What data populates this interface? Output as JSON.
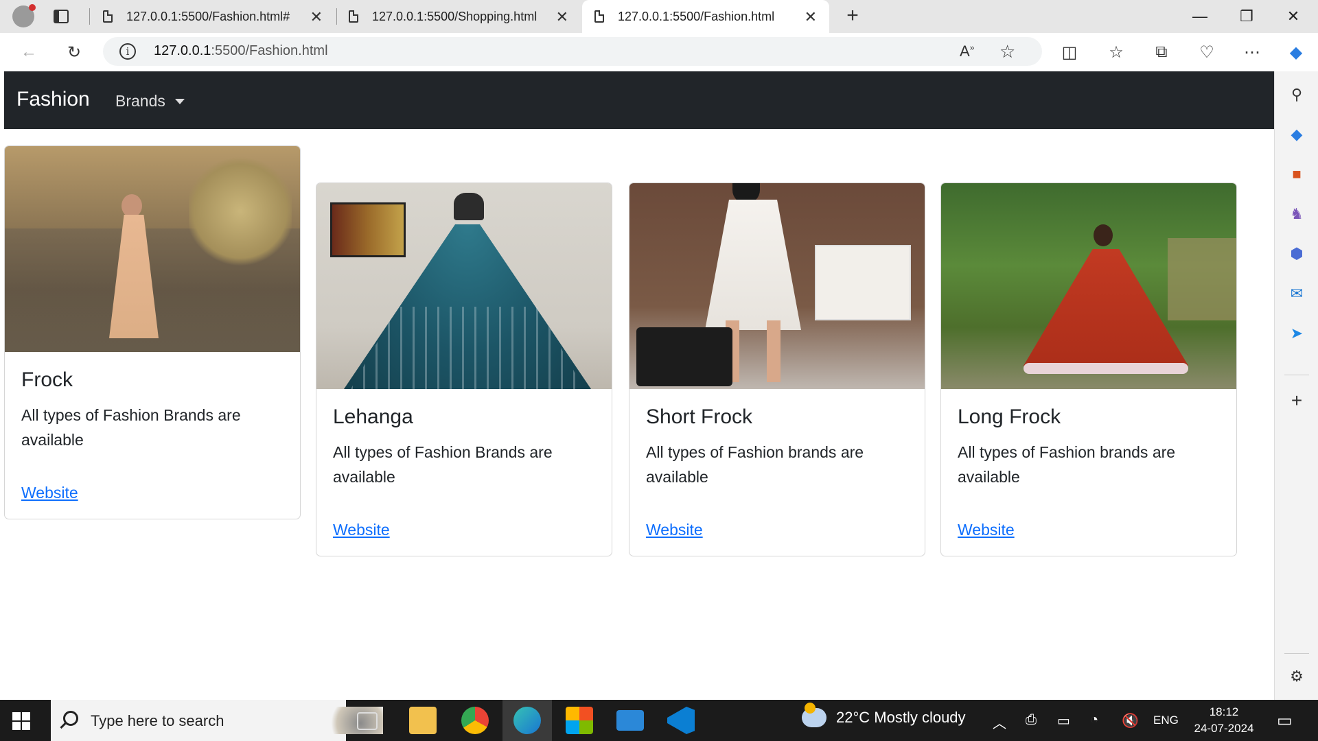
{
  "browser": {
    "tabs": [
      {
        "title": "127.0.0.1:5500/Fashion.html#",
        "active": false
      },
      {
        "title": "127.0.0.1:5500/Shopping.html",
        "active": false
      },
      {
        "title": "127.0.0.1:5500/Fashion.html",
        "active": true
      }
    ],
    "url_host": "127.0.0.1",
    "url_path": ":5500/Fashion.html"
  },
  "page": {
    "navbar": {
      "brand": "Fashion",
      "dropdown_label": "Brands"
    },
    "cards": [
      {
        "title": "Frock",
        "text": "All types of Fashion Brands are available",
        "link": "Website"
      },
      {
        "title": "Lehanga",
        "text": "All types of Fashion Brands are available",
        "link": "Website"
      },
      {
        "title": "Short Frock",
        "text": "All types of Fashion brands are available",
        "link": "Website"
      },
      {
        "title": "Long Frock",
        "text": "All types of Fashion brands are available",
        "link": "Website"
      }
    ]
  },
  "taskbar": {
    "search_placeholder": "Type here to search",
    "weather": "22°C  Mostly cloudy",
    "language": "ENG",
    "time": "18:12",
    "date": "24-07-2024"
  },
  "colors": {
    "navbar": "#212529",
    "link": "#0d6efd",
    "taskbar": "#1b1b1b"
  }
}
